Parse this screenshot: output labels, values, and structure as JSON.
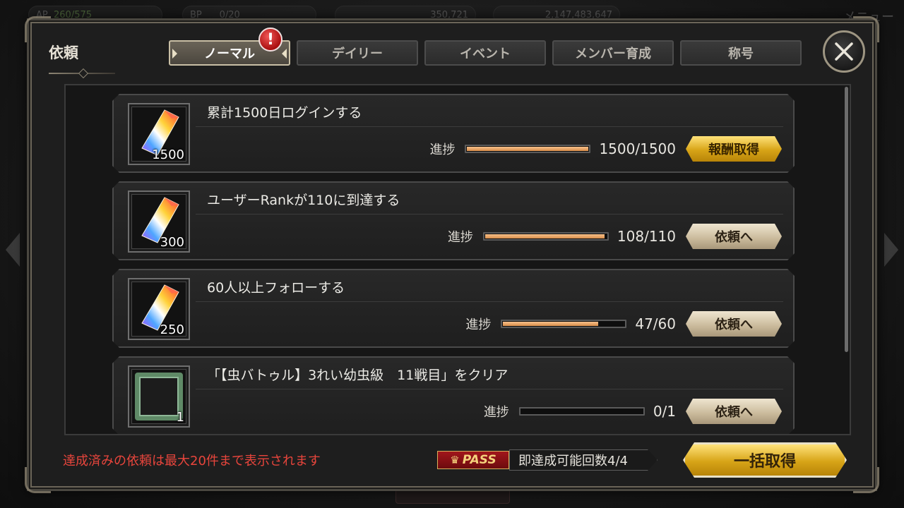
{
  "background": {
    "hud": [
      {
        "label": "AP",
        "value": "260/575"
      },
      {
        "label": "BP",
        "value": "0/20"
      },
      {
        "label": "",
        "value": "350,721"
      },
      {
        "label": "",
        "value": "2,147,483,647"
      }
    ],
    "menu_label": "メニュー"
  },
  "panel": {
    "title": "依頼",
    "tabs": [
      {
        "label": "ノーマル",
        "active": true
      },
      {
        "label": "デイリー",
        "active": false
      },
      {
        "label": "イベント",
        "active": false
      },
      {
        "label": "メンバー育成",
        "active": false
      },
      {
        "label": "称号",
        "active": false
      }
    ],
    "alert_badge": "!",
    "close_icon": "close-x-icon"
  },
  "quests": [
    {
      "title": "累計1500日ログインする",
      "reward_icon": "crystal-icon",
      "reward_qty": "1500",
      "progress_label": "進捗",
      "progress_value": "1500/1500",
      "progress_fraction": 1.0,
      "button_label": "報酬取得",
      "button_style": "gold"
    },
    {
      "title": "ユーザーRankが110に到達する",
      "reward_icon": "crystal-icon",
      "reward_qty": "300",
      "progress_label": "進捗",
      "progress_value": "108/110",
      "progress_fraction": 0.982,
      "button_label": "依頼へ",
      "button_style": "beige"
    },
    {
      "title": "60人以上フォローする",
      "reward_icon": "crystal-icon",
      "reward_qty": "250",
      "progress_label": "進捗",
      "progress_value": "47/60",
      "progress_fraction": 0.783,
      "button_label": "依頼へ",
      "button_style": "beige"
    },
    {
      "title": "「【虫バトゥル】3れい幼虫級　11戦目」をクリア",
      "reward_icon": "frame-icon",
      "reward_qty": "1",
      "progress_label": "進捗",
      "progress_value": "0/1",
      "progress_fraction": 0.0,
      "button_label": "依頼へ",
      "button_style": "beige"
    }
  ],
  "footer": {
    "note": "達成済みの依頼は最大20件まで表示されます",
    "pass_label": "PASS",
    "instant_clear": "即達成可能回数4/4",
    "claim_all_label": "一括取得"
  },
  "colors": {
    "note_red": "#e8453c",
    "gold_button": "#d7a417",
    "progress_fill": "#e9a15f"
  }
}
